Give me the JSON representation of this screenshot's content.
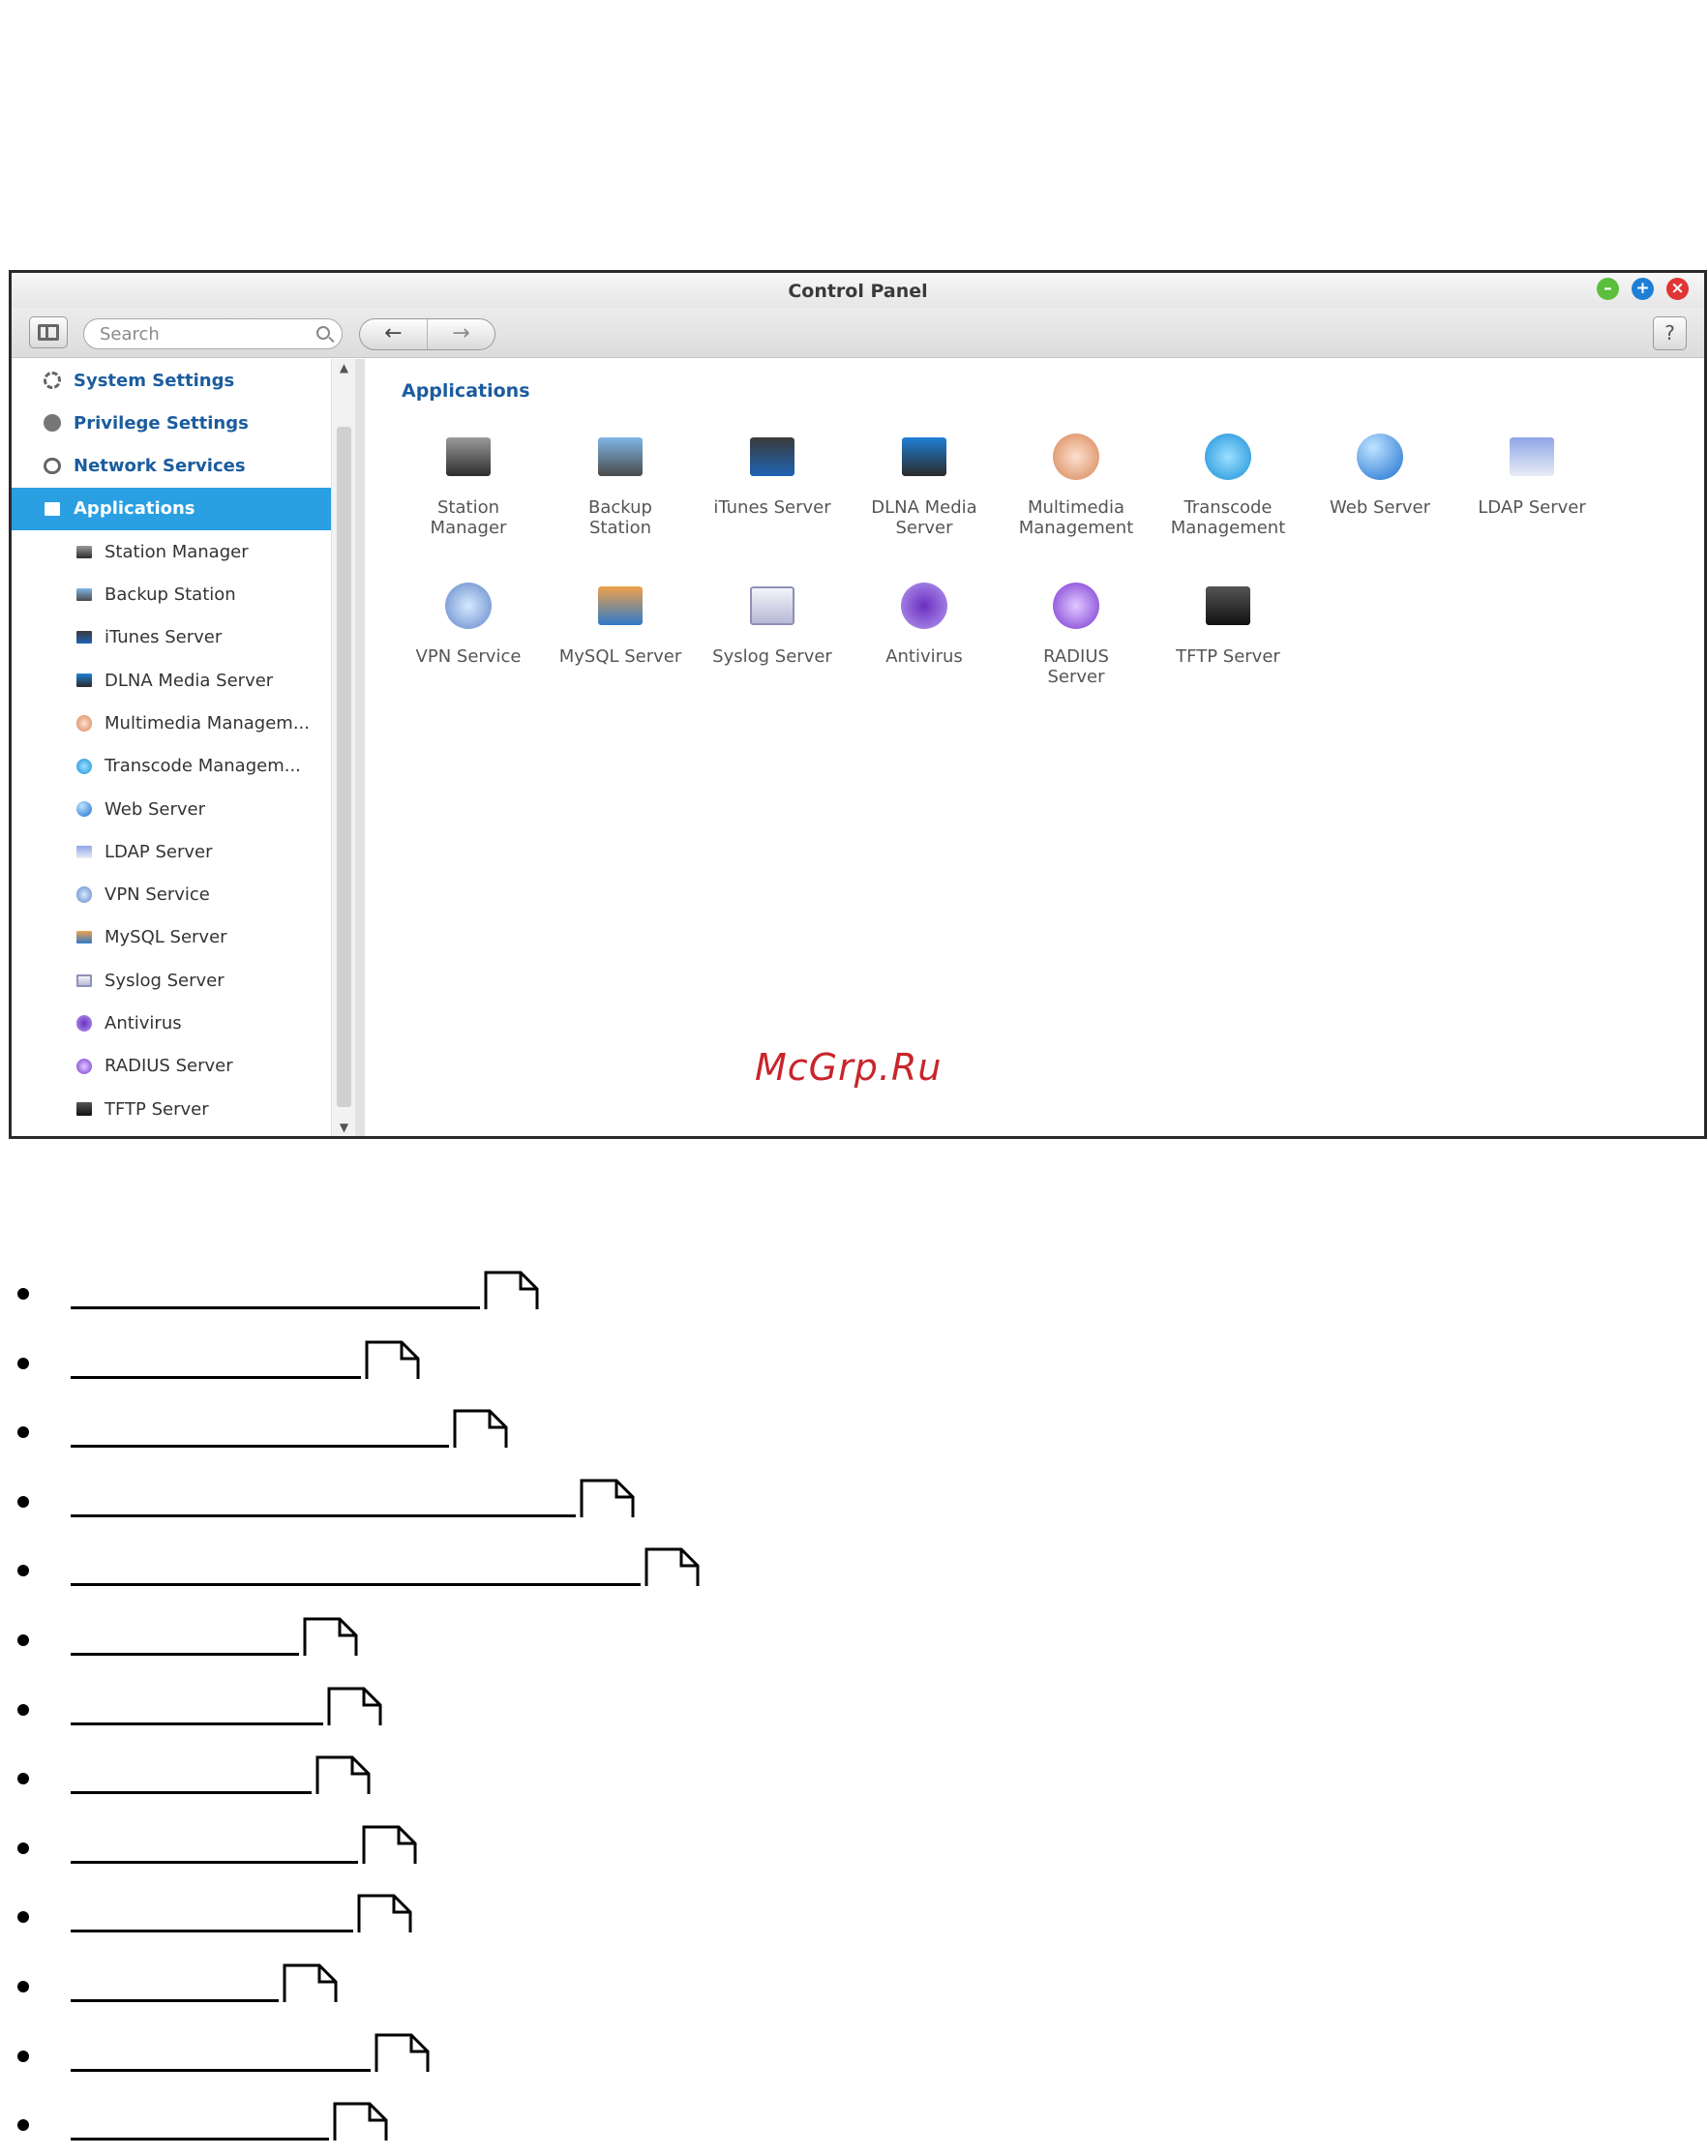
{
  "window": {
    "title": "Control Panel",
    "search_placeholder": "Search",
    "back_label": "←",
    "forward_label": "→",
    "help_label": "?",
    "colors": {
      "accent": "#2a9fe2",
      "heading": "#1b5c9e",
      "minimize": "#5bbf3c",
      "maximize": "#1f7fd6",
      "close": "#e03535"
    }
  },
  "sidebar": {
    "items": [
      {
        "label": "System Settings",
        "icon": "gear-icon",
        "level": "top"
      },
      {
        "label": "Privilege Settings",
        "icon": "user-icon",
        "level": "top"
      },
      {
        "label": "Network Services",
        "icon": "globe-icon",
        "level": "top"
      },
      {
        "label": "Applications",
        "icon": "applications-icon",
        "level": "top",
        "active": true
      },
      {
        "label": "Station Manager",
        "icon": "station-manager-icon",
        "level": "sub"
      },
      {
        "label": "Backup Station",
        "icon": "backup-station-icon",
        "level": "sub"
      },
      {
        "label": "iTunes Server",
        "icon": "itunes-server-icon",
        "level": "sub"
      },
      {
        "label": "DLNA Media Server",
        "icon": "dlna-media-server-icon",
        "level": "sub"
      },
      {
        "label": "Multimedia Managem...",
        "icon": "multimedia-management-icon",
        "level": "sub"
      },
      {
        "label": "Transcode Managem...",
        "icon": "transcode-management-icon",
        "level": "sub"
      },
      {
        "label": "Web Server",
        "icon": "web-server-icon",
        "level": "sub"
      },
      {
        "label": "LDAP Server",
        "icon": "ldap-server-icon",
        "level": "sub"
      },
      {
        "label": "VPN Service",
        "icon": "vpn-service-icon",
        "level": "sub"
      },
      {
        "label": "MySQL Server",
        "icon": "mysql-server-icon",
        "level": "sub"
      },
      {
        "label": "Syslog Server",
        "icon": "syslog-server-icon",
        "level": "sub"
      },
      {
        "label": "Antivirus",
        "icon": "antivirus-icon",
        "level": "sub"
      },
      {
        "label": "RADIUS Server",
        "icon": "radius-server-icon",
        "level": "sub"
      },
      {
        "label": "TFTP Server",
        "icon": "tftp-server-icon",
        "level": "sub"
      }
    ]
  },
  "main": {
    "section_title": "Applications",
    "apps": [
      {
        "line1": "Station",
        "line2": "Manager",
        "icon": "station-manager-icon"
      },
      {
        "line1": "Backup",
        "line2": "Station",
        "icon": "backup-station-icon"
      },
      {
        "line1": "iTunes Server",
        "line2": "",
        "icon": "itunes-server-icon"
      },
      {
        "line1": "DLNA Media",
        "line2": "Server",
        "icon": "dlna-media-server-icon"
      },
      {
        "line1": "Multimedia",
        "line2": "Management",
        "icon": "multimedia-management-icon"
      },
      {
        "line1": "Transcode",
        "line2": "Management",
        "icon": "transcode-management-icon"
      },
      {
        "line1": "Web Server",
        "line2": "",
        "icon": "web-server-icon"
      },
      {
        "line1": "LDAP Server",
        "line2": "",
        "icon": "ldap-server-icon"
      },
      {
        "line1": "VPN Service",
        "line2": "",
        "icon": "vpn-service-icon"
      },
      {
        "line1": "MySQL Server",
        "line2": "",
        "icon": "mysql-server-icon"
      },
      {
        "line1": "Syslog Server",
        "line2": "",
        "icon": "syslog-server-icon"
      },
      {
        "line1": "Antivirus",
        "line2": "",
        "icon": "antivirus-icon"
      },
      {
        "line1": "RADIUS",
        "line2": "Server",
        "icon": "radius-server-icon"
      },
      {
        "line1": "TFTP Server",
        "line2": "",
        "icon": "tftp-server-icon"
      }
    ]
  },
  "watermark": "McGrp.Ru",
  "link_list": {
    "icon": "external-link-icon",
    "count": 13
  }
}
